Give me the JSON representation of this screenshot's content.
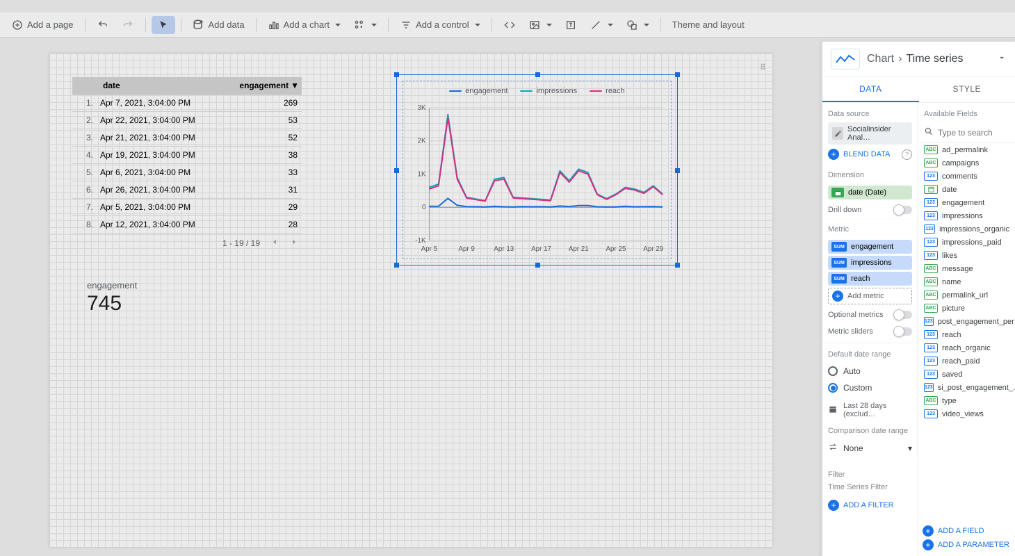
{
  "toolbar": {
    "add_page": "Add a page",
    "add_data": "Add data",
    "add_chart": "Add a chart",
    "add_control": "Add a control",
    "theme_layout": "Theme and layout"
  },
  "table": {
    "headers": {
      "date": "date",
      "engagement": "engagement"
    },
    "rows": [
      {
        "n": "1.",
        "date": "Apr 7, 2021, 3:04:00 PM",
        "val": "269"
      },
      {
        "n": "2.",
        "date": "Apr 22, 2021, 3:04:00 PM",
        "val": "53"
      },
      {
        "n": "3.",
        "date": "Apr 21, 2021, 3:04:00 PM",
        "val": "52"
      },
      {
        "n": "4.",
        "date": "Apr 19, 2021, 3:04:00 PM",
        "val": "38"
      },
      {
        "n": "5.",
        "date": "Apr 6, 2021, 3:04:00 PM",
        "val": "33"
      },
      {
        "n": "6.",
        "date": "Apr 26, 2021, 3:04:00 PM",
        "val": "31"
      },
      {
        "n": "7.",
        "date": "Apr 5, 2021, 3:04:00 PM",
        "val": "29"
      },
      {
        "n": "8.",
        "date": "Apr 12, 2021, 3:04:00 PM",
        "val": "28"
      }
    ],
    "pager": "1 - 19 / 19"
  },
  "scorecard": {
    "label": "engagement",
    "value": "745"
  },
  "chart_data": {
    "type": "line",
    "title": "",
    "legend": [
      "engagement",
      "impressions",
      "reach"
    ],
    "colors": {
      "engagement": "#1a73e8",
      "impressions": "#12b5cb",
      "reach": "#e8348d"
    },
    "ylabel": "",
    "xlabel": "",
    "ylim": [
      -1000,
      3000
    ],
    "yticks": [
      "3K",
      "2K",
      "1K",
      "0",
      "-1K"
    ],
    "xticks": [
      "Apr 5",
      "Apr 9",
      "Apr 13",
      "Apr 17",
      "Apr 21",
      "Apr 25",
      "Apr 29"
    ],
    "x": [
      "Apr 5",
      "Apr 6",
      "Apr 7",
      "Apr 8",
      "Apr 9",
      "Apr 10",
      "Apr 11",
      "Apr 12",
      "Apr 13",
      "Apr 14",
      "Apr 15",
      "Apr 16",
      "Apr 17",
      "Apr 18",
      "Apr 19",
      "Apr 20",
      "Apr 21",
      "Apr 22",
      "Apr 23",
      "Apr 24",
      "Apr 25",
      "Apr 26",
      "Apr 27",
      "Apr 28",
      "Apr 29",
      "Apr 30"
    ],
    "series": [
      {
        "name": "engagement",
        "values": [
          29,
          33,
          269,
          60,
          20,
          15,
          10,
          28,
          15,
          10,
          20,
          15,
          18,
          12,
          38,
          20,
          52,
          53,
          15,
          10,
          12,
          31,
          15,
          18,
          20,
          12
        ]
      },
      {
        "name": "impressions",
        "values": [
          600,
          700,
          2800,
          900,
          300,
          250,
          200,
          850,
          900,
          300,
          280,
          260,
          240,
          220,
          1100,
          800,
          1150,
          1050,
          400,
          260,
          400,
          600,
          550,
          450,
          650,
          400
        ]
      },
      {
        "name": "reach",
        "values": [
          550,
          650,
          2700,
          850,
          280,
          230,
          190,
          800,
          850,
          280,
          260,
          240,
          220,
          200,
          1050,
          760,
          1100,
          1000,
          380,
          240,
          380,
          570,
          520,
          420,
          620,
          380
        ]
      }
    ]
  },
  "panel": {
    "breadcrumb": {
      "chart": "Chart",
      "type": "Time series"
    },
    "tabs": {
      "data": "DATA",
      "style": "STYLE"
    },
    "data_source_label": "Data source",
    "data_source_name": "Socialinsider Anal…",
    "blend": "BLEND DATA",
    "dimension_label": "Dimension",
    "dimension_value": "date (Date)",
    "drilldown": "Drill down",
    "metric_label": "Metric",
    "metrics": [
      "engagement",
      "impressions",
      "reach"
    ],
    "add_metric": "Add metric",
    "optional_metrics": "Optional metrics",
    "metric_sliders": "Metric sliders",
    "default_date": "Default date range",
    "date_auto": "Auto",
    "date_custom": "Custom",
    "date_value": "Last 28 days (exclud…",
    "comparison_label": "Comparison date range",
    "comparison_value": "None",
    "filter_label": "Filter",
    "ts_filter_label": "Time Series Filter",
    "add_filter": "ADD A FILTER",
    "available_fields_label": "Available Fields",
    "search_placeholder": "Type to search",
    "fields": [
      {
        "t": "abc",
        "n": "ad_permalink"
      },
      {
        "t": "abc",
        "n": "campaigns"
      },
      {
        "t": "num",
        "n": "comments"
      },
      {
        "t": "dte",
        "n": "date"
      },
      {
        "t": "num",
        "n": "engagement"
      },
      {
        "t": "num",
        "n": "impressions"
      },
      {
        "t": "num",
        "n": "impressions_organic"
      },
      {
        "t": "num",
        "n": "impressions_paid"
      },
      {
        "t": "num",
        "n": "likes"
      },
      {
        "t": "abc",
        "n": "message"
      },
      {
        "t": "abc",
        "n": "name"
      },
      {
        "t": "abc",
        "n": "permalink_url"
      },
      {
        "t": "abc",
        "n": "picture"
      },
      {
        "t": "num",
        "n": "post_engagement_per…"
      },
      {
        "t": "num",
        "n": "reach"
      },
      {
        "t": "num",
        "n": "reach_organic"
      },
      {
        "t": "num",
        "n": "reach_paid"
      },
      {
        "t": "num",
        "n": "saved"
      },
      {
        "t": "num",
        "n": "si_post_engagement_…"
      },
      {
        "t": "abc",
        "n": "type"
      },
      {
        "t": "num",
        "n": "video_views"
      }
    ],
    "add_field": "ADD A FIELD",
    "add_param": "ADD A PARAMETER"
  }
}
